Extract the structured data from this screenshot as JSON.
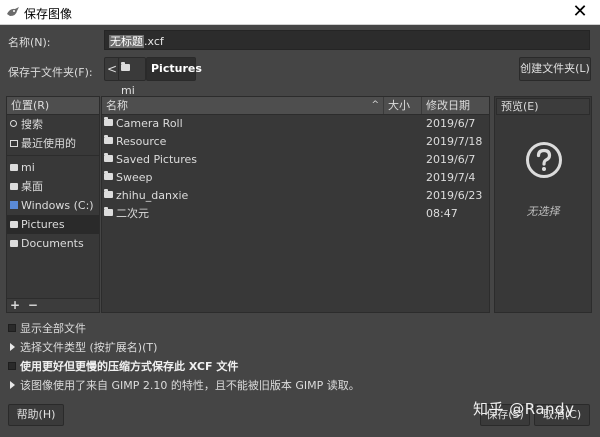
{
  "window": {
    "title": "保存图像",
    "close_glyph": "✕"
  },
  "name_row": {
    "label": "名称(N):",
    "value_selected": "无标题",
    "value_ext": ".xcf"
  },
  "folder_row": {
    "label": "保存于文件夹(F):",
    "back_glyph": "<",
    "crumbs": [
      "mi",
      "Pictures"
    ],
    "create_folder": "创建文件夹(L)"
  },
  "places": {
    "header": "位置(R)",
    "items": [
      {
        "label": "搜索",
        "icon": "search-icon"
      },
      {
        "label": "最近使用的",
        "icon": "recent-icon"
      },
      {
        "label": "mi",
        "icon": "folder-icon"
      },
      {
        "label": "桌面",
        "icon": "folder-icon"
      },
      {
        "label": "Windows (C:)",
        "icon": "windows-drive-icon"
      },
      {
        "label": "Pictures",
        "icon": "folder-icon"
      },
      {
        "label": "Documents",
        "icon": "folder-icon"
      }
    ],
    "footer_add": "+",
    "footer_remove": "−"
  },
  "files": {
    "headers": {
      "name": "名称",
      "size": "大小",
      "modified": "修改日期"
    },
    "sort_glyph": "^",
    "rows": [
      {
        "name": "Camera Roll",
        "date": "2019/6/7"
      },
      {
        "name": "Resource",
        "date": "2019/7/18"
      },
      {
        "name": "Saved Pictures",
        "date": "2019/6/7"
      },
      {
        "name": "Sweep",
        "date": "2019/7/4"
      },
      {
        "name": "zhihu_danxie",
        "date": "2019/6/23"
      },
      {
        "name": "二次元",
        "date": "08:47"
      }
    ]
  },
  "preview": {
    "header": "预览(E)",
    "no_selection": "无选择"
  },
  "options": {
    "show_all": "显示全部文件",
    "select_type": "选择文件类型 (按扩展名)(T)",
    "compress": "使用更好但更慢的压缩方式保存此 XCF 文件",
    "gimp_notice": "该图像使用了来自 GIMP 2.10 的特性，且不能被旧版本 GIMP 读取。"
  },
  "buttons": {
    "help": "帮助(H)",
    "save": "保存(S)",
    "cancel": "取消(C)"
  },
  "watermark": "知乎 @Randy"
}
